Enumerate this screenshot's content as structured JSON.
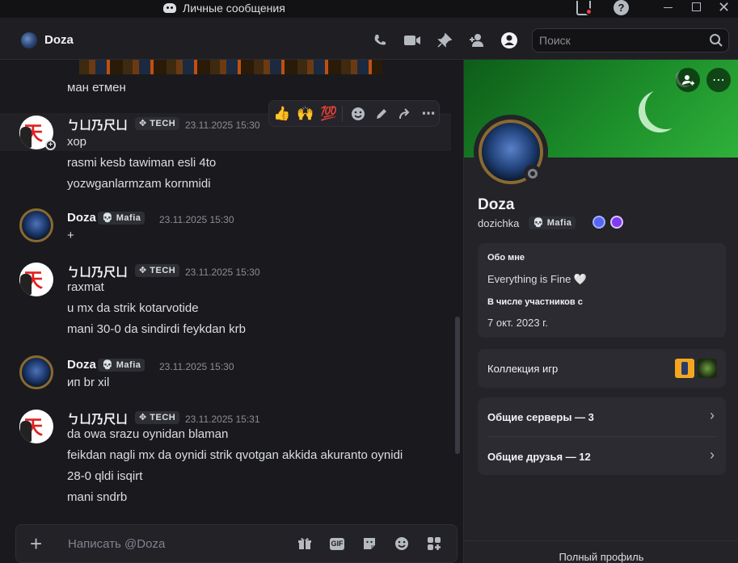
{
  "titlebar": {
    "title": "Личные сообщения"
  },
  "header": {
    "name": "Doza",
    "search_placeholder": "Поиск"
  },
  "chat": {
    "top_text": "ман етмен",
    "reactions": [
      "👍",
      "🙌",
      "💯"
    ],
    "groups": [
      {
        "author": "ㄅㄩ乃尺ㄩ",
        "tag": "TECH",
        "tag_icon": "✥",
        "time": "23.11.2025 15:30",
        "avatar": "subra-avatar",
        "lines": [
          "хор",
          "rasmi kesb tawiman esli 4to",
          "yozwganlarmzam kornmidi"
        ]
      },
      {
        "author": "Doza",
        "tag": "Mafia",
        "tag_icon": "💀",
        "time": "23.11.2025 15:30",
        "avatar": "doza-avatar",
        "lines": [
          "+"
        ]
      },
      {
        "author": "ㄅㄩ乃尺ㄩ",
        "tag": "TECH",
        "tag_icon": "✥",
        "time": "23.11.2025 15:30",
        "avatar": "subra-avatar",
        "lines": [
          "raxmat",
          "u mx da strik kotarvotide",
          "mani 30-0 da sindirdi feykdan krb"
        ]
      },
      {
        "author": "Doza",
        "tag": "Mafia",
        "tag_icon": "💀",
        "time": "23.11.2025 15:30",
        "avatar": "doza-avatar",
        "lines": [
          "ип br xil"
        ]
      },
      {
        "author": "ㄅㄩ乃尺ㄩ",
        "tag": "TECH",
        "tag_icon": "✥",
        "time": "23.11.2025 15:31",
        "avatar": "subra-avatar",
        "lines": [
          "da owa srazu oynidan blaman",
          "feikdan nagli mx da oynidi strik qvotgan akkida akuranto oynidi",
          "28-0 qldi isqirt",
          "mani sndrb"
        ]
      }
    ]
  },
  "composer": {
    "placeholder": "Написать @Doza",
    "gif_label": "GIF"
  },
  "profile": {
    "display_name": "Doza",
    "username": "dozichka",
    "guild_tag": "Mafia",
    "guild_tag_icon": "💀",
    "about_heading": "Обо мне",
    "about_text": "Everything is Fine 🤍",
    "member_since_heading": "В числе участников с",
    "member_since": "7 окт. 2023 г.",
    "games_label": "Коллекция игр",
    "mutual_servers": "Общие серверы — 3",
    "mutual_friends": "Общие друзья — 12",
    "full_profile": "Полный профиль"
  },
  "colors": {
    "banner": "#1c8d2a",
    "background": "#1a1a1e",
    "panel": "#232328"
  }
}
